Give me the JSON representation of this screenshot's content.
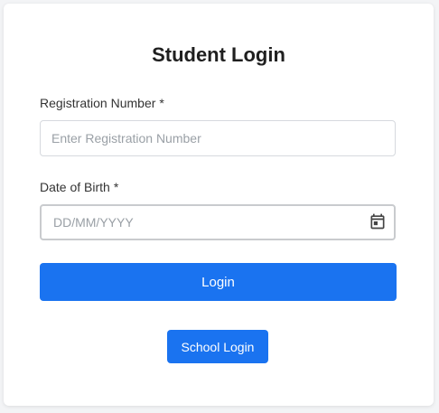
{
  "form": {
    "title": "Student Login",
    "registration": {
      "label": "Registration Number",
      "required_mark": "*",
      "placeholder": "Enter Registration Number",
      "value": ""
    },
    "dob": {
      "label": "Date of Birth",
      "required_mark": "*",
      "placeholder": "DD/MM/YYYY",
      "icon": "calendar-icon"
    },
    "login_button": "Login",
    "school_login_button": "School Login"
  },
  "colors": {
    "primary": "#1a73f0",
    "background": "#f3f4f6",
    "card": "#ffffff"
  }
}
